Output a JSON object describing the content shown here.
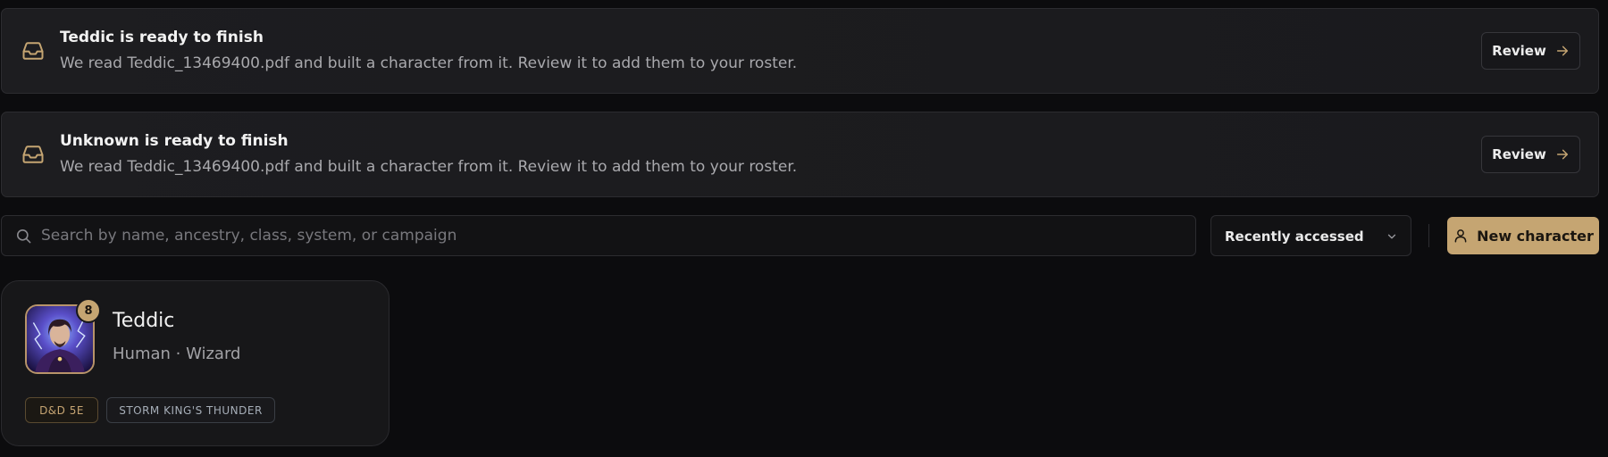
{
  "banners": [
    {
      "title": "Teddic is ready to finish",
      "message": "We read Teddic_13469400.pdf and built a character from it. Review it to add them to your roster.",
      "button_label": "Review",
      "icon": "inbox-icon"
    },
    {
      "title": "Unknown is ready to finish",
      "message": "We read Teddic_13469400.pdf and built a character from it. Review it to add them to your roster.",
      "button_label": "Review",
      "icon": "inbox-icon"
    }
  ],
  "toolbar": {
    "search_placeholder": "Search by name, ancestry, class, system, or campaign",
    "search_value": "",
    "sort_selected": "Recently accessed",
    "new_character_label": "New character"
  },
  "characters": [
    {
      "name": "Teddic",
      "subtitle": "Human · Wizard",
      "level": "8",
      "tags": [
        "D&D 5E",
        "STORM KING'S THUNDER"
      ]
    }
  ],
  "colors": {
    "accent": "#c5a572",
    "background": "#0c0c0e",
    "panel": "#1d1d20"
  }
}
